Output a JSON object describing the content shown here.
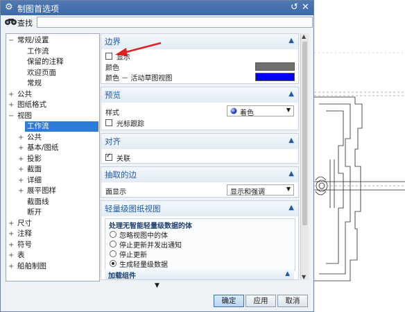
{
  "window": {
    "title": "制图首选项"
  },
  "search": {
    "label": "查找",
    "placeholder": ""
  },
  "tree": {
    "items": [
      {
        "label": "常规/设置",
        "expander": "-"
      },
      {
        "label": "工作流",
        "expander": ""
      },
      {
        "label": "保留的注释",
        "expander": ""
      },
      {
        "label": "欢迎页面",
        "expander": ""
      },
      {
        "label": "常规",
        "expander": ""
      },
      {
        "label": "公共",
        "expander": "+"
      },
      {
        "label": "图纸格式",
        "expander": "+"
      },
      {
        "label": "视图",
        "expander": "-"
      },
      {
        "label": "工作流",
        "expander": "",
        "selected": true
      },
      {
        "label": "公共",
        "expander": "+"
      },
      {
        "label": "基本/图纸",
        "expander": "+"
      },
      {
        "label": "投影",
        "expander": "+"
      },
      {
        "label": "截面",
        "expander": "+"
      },
      {
        "label": "详细",
        "expander": "+"
      },
      {
        "label": "展平图样",
        "expander": "+"
      },
      {
        "label": "截面线",
        "expander": ""
      },
      {
        "label": "断开",
        "expander": ""
      },
      {
        "label": "尺寸",
        "expander": "+"
      },
      {
        "label": "注释",
        "expander": "+"
      },
      {
        "label": "符号",
        "expander": "+"
      },
      {
        "label": "表",
        "expander": "+"
      },
      {
        "label": "船舶制图",
        "expander": "+"
      }
    ]
  },
  "sections": {
    "boundary": {
      "title": "边界",
      "show_label": "显示",
      "show_checked": false,
      "color_label": "颜色",
      "color_value": "#707070",
      "active_color_label": "颜色 － 活动草图视图",
      "active_color_value": "#0000ff"
    },
    "preview": {
      "title": "预览",
      "style_label": "样式",
      "style_value": "着色",
      "cursor_track_label": "光标跟踪",
      "cursor_track_checked": false
    },
    "align": {
      "title": "对齐",
      "associate_label": "关联",
      "associate_checked": true
    },
    "extracted_edges": {
      "title": "抽取的边",
      "face_display_label": "面显示",
      "face_display_value": "显示和强调"
    },
    "lightweight": {
      "title": "轻量级图纸视图",
      "group_title": "处理无智能轻量级数据的体",
      "options": [
        "忽略视图中的体",
        "停止更新并发出通知",
        "停止更新",
        "生成轻量级数据"
      ],
      "selected_index": 3,
      "load_components_title": "加载组件"
    }
  },
  "buttons": {
    "ok": "确定",
    "apply": "应用",
    "cancel": "取消"
  },
  "colors": {
    "titlebar": "#3d6aa9",
    "selection": "#2f7bd9",
    "annotation_arrow": "#e02020"
  }
}
